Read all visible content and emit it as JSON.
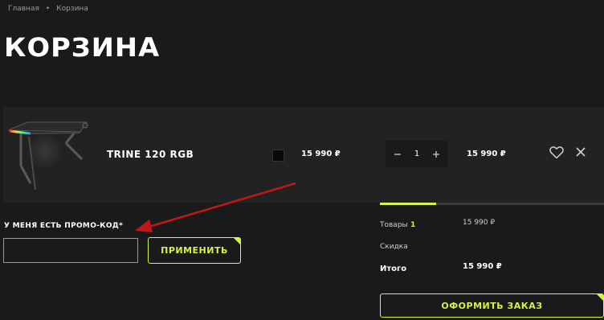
{
  "breadcrumb": {
    "home": "Главная",
    "separator": "•",
    "current": "Корзина"
  },
  "page": {
    "title": "КОРЗИНА"
  },
  "cart": {
    "items": [
      {
        "name": "TRINE 120 RGB",
        "color": "#0a0a0a",
        "price": "15 990 ₽",
        "quantity": "1",
        "total": "15 990 ₽"
      }
    ]
  },
  "promo": {
    "label": "У МЕНЯ ЕСТЬ ПРОМО-КОД*",
    "value": "",
    "apply_label": "ПРИМЕНИТЬ"
  },
  "summary": {
    "goods_label": "Товары",
    "goods_count": "1",
    "goods_value": "15 990 ₽",
    "discount_label": "Скидка",
    "total_label": "Итого",
    "total_value": "15 990 ₽",
    "order_label": "ОФОРМИТЬ ЗАКАЗ"
  },
  "colors": {
    "accent": "#d4f542",
    "background": "#1a1a1a",
    "row": "#222222",
    "annotation_arrow": "#c01818"
  },
  "icons": [
    "minus-icon",
    "plus-icon",
    "heart-icon",
    "close-icon"
  ]
}
